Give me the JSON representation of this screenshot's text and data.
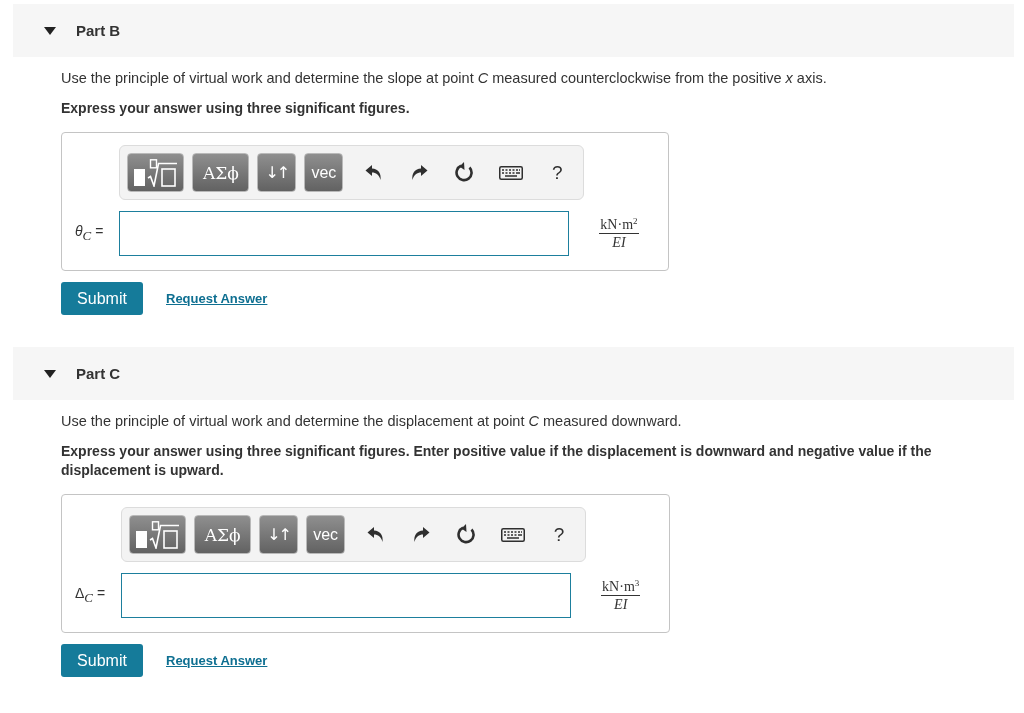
{
  "parts": [
    {
      "title": "Part B",
      "expanded": true,
      "prompt": "Use the principle of virtual work and determine the slope at point *C* measured counterclockwise from the positive *x* axis.",
      "instruction": "Express your answer using three significant figures.",
      "toolbar": [
        {
          "kind": "templates"
        },
        {
          "kind": "symbols",
          "label": "ΑΣϕ"
        },
        {
          "kind": "arrows",
          "label": "↓↑"
        },
        {
          "kind": "text",
          "label": "vec"
        },
        {
          "kind": "undo"
        },
        {
          "kind": "redo"
        },
        {
          "kind": "reset"
        },
        {
          "kind": "keyboard"
        },
        {
          "kind": "help",
          "label": "?"
        }
      ],
      "answer": {
        "label": "*θ*$_{C}$ =",
        "units": {
          "numerator": "kN·m$^{2}$",
          "denominator": "EI"
        }
      },
      "buttons": {
        "submit": "Submit",
        "request": "Request Answer"
      }
    },
    {
      "title": "Part C",
      "expanded": true,
      "prompt": "Use the principle of virtual work and determine the displacement at point *C* measured downward.",
      "instruction": "Express your answer using three significant figures. Enter positive value if the displacement is downward and negative value if the displacement is upward.",
      "toolbar": [
        {
          "kind": "templates"
        },
        {
          "kind": "symbols",
          "label": "ΑΣϕ"
        },
        {
          "kind": "arrows",
          "label": "↓↑"
        },
        {
          "kind": "text",
          "label": "vec"
        },
        {
          "kind": "undo"
        },
        {
          "kind": "redo"
        },
        {
          "kind": "reset"
        },
        {
          "kind": "keyboard"
        },
        {
          "kind": "help",
          "label": "?"
        }
      ],
      "answer": {
        "label": "Δ$_{C}$ =",
        "units": {
          "numerator": "kN·m$^{3}$",
          "denominator": "EI"
        }
      },
      "buttons": {
        "submit": "Submit",
        "request": "Request Answer"
      }
    }
  ]
}
